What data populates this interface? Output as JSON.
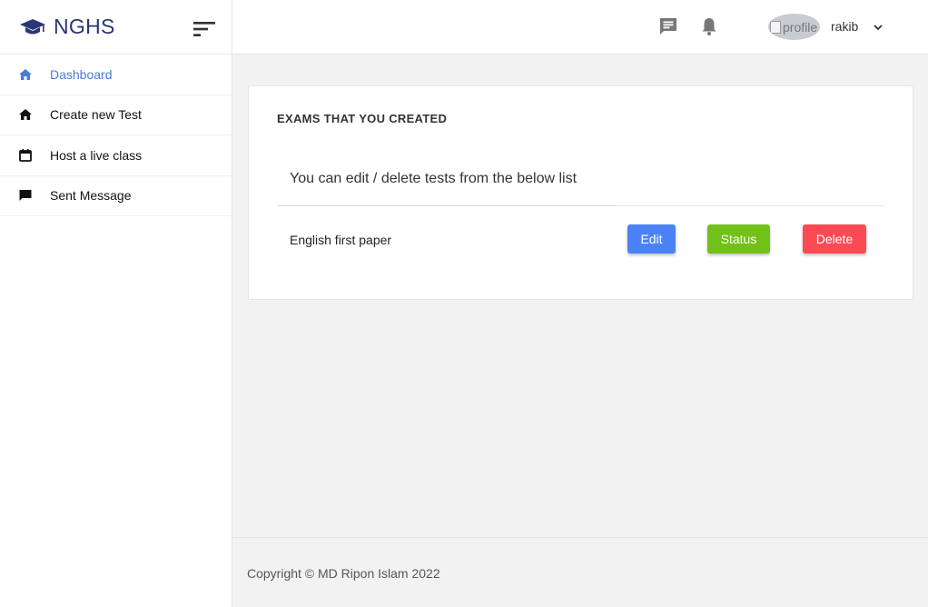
{
  "brand": {
    "name": "NGHS",
    "icon": "graduation-cap-icon",
    "color": "#2b3674"
  },
  "sidebar": {
    "items": [
      {
        "label": "Dashboard",
        "icon": "home-icon",
        "active": true
      },
      {
        "label": "Create new Test",
        "icon": "home-icon",
        "active": false
      },
      {
        "label": "Host a live class",
        "icon": "calendar-icon",
        "active": false
      },
      {
        "label": "Sent Message",
        "icon": "message-icon",
        "active": false
      }
    ]
  },
  "topbar": {
    "avatar_alt": "profile",
    "username": "rakib",
    "icons": [
      "chat-icon",
      "bell-icon",
      "chevron-down-icon"
    ]
  },
  "main": {
    "card_title": "EXAMS THAT YOU CREATED",
    "card_subtitle": "You can edit / delete tests from the below list",
    "exams": [
      {
        "name": "English first paper"
      }
    ],
    "actions": {
      "edit": "Edit",
      "status": "Status",
      "delete": "Delete"
    }
  },
  "footer": {
    "copyright": "Copyright © MD Ripon Islam 2022"
  },
  "colors": {
    "accent": "#4a7bd8",
    "edit": "#4b82f7",
    "status": "#72c01a",
    "delete": "#fb4a53"
  }
}
